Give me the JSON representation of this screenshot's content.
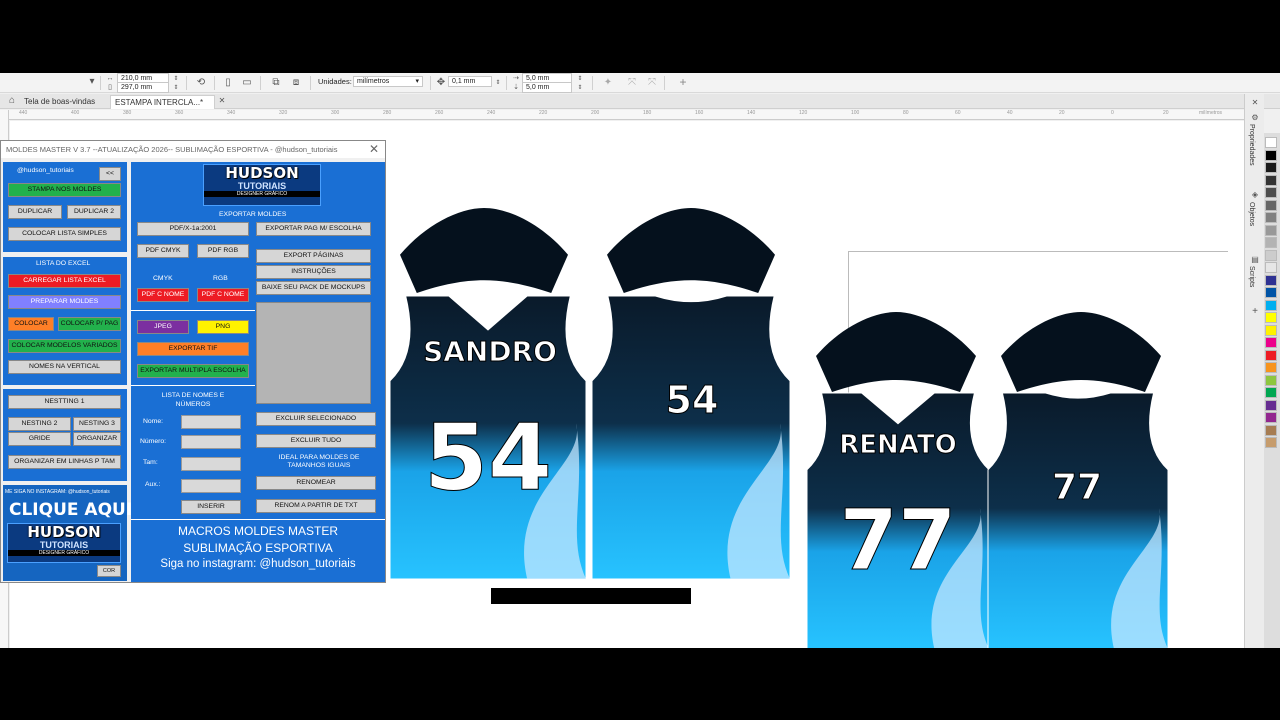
{
  "propbar": {
    "width": "210,0 mm",
    "height": "297,0 mm",
    "units_label": "Unidades:",
    "units_value": "milímetros",
    "nudge": "0,1 mm",
    "dup_x": "5,0 mm",
    "dup_y": "5,0 mm"
  },
  "tabs": {
    "welcome": "Tela de boas-vindas",
    "document": "ESTAMPA INTERCLA...*"
  },
  "ruler": {
    "ticks": [
      "440",
      "400",
      "380",
      "360",
      "340",
      "320",
      "300",
      "280",
      "260",
      "240",
      "220",
      "200",
      "180",
      "160",
      "140",
      "120",
      "100",
      "80",
      "60",
      "40",
      "20",
      "0",
      "20"
    ],
    "unit": "milímetros"
  },
  "docker": {
    "tab1": "Propriedades",
    "tab2": "Objetos",
    "tab3": "Scripts"
  },
  "palette": [
    "#ffffff",
    "#000000",
    "#1a1a1a",
    "#333333",
    "#4d4d4d",
    "#666666",
    "#808080",
    "#999999",
    "#b3b3b3",
    "#cccccc",
    "#e6e6e6",
    "#2e3192",
    "#0054a6",
    "#00aeef",
    "#ffff00",
    "#fff200",
    "#ec008c",
    "#ed1c24",
    "#f7941d",
    "#8dc63f",
    "#00a651",
    "#662d91",
    "#92278f",
    "#a67c52",
    "#c69c6d"
  ],
  "dialog": {
    "title": "MOLDES  MASTER V 3.7 --ATUALIZAÇÃO 2026--  SUBLIMAÇÃO ESPORTIVA - @hudson_tutoriais",
    "handle": "@hudson_tutoriais",
    "collapse": "<<",
    "stampa": "STAMPA NOS  MOLDES",
    "duplicar": "DUPLICAR",
    "duplicar2": "DUPLICAR 2",
    "colocar_lista": "COLOCAR LISTA SIMPLES",
    "lista_excel_label": "LISTA DO EXCEL",
    "carregar": "CARREGAR LISTA EXCEL",
    "preparar": "PREPARAR MOLDES",
    "colocar": "COLOCAR",
    "colocar_pag": "COLOCAR P/ PAG",
    "colocar_variados": "COLOCAR MODELOS VARIADOS",
    "nomes_vertical": "NOMES NA VERTICAL",
    "nesting1": "NESTTING 1",
    "nesting2": "NESTING 2",
    "nesting3": "NESTING 3",
    "gride": "GRIDE",
    "organizar": "ORGANIZAR",
    "organizar_linhas": "ORGANIZAR EM LINHAS P TAM",
    "instagram_small": "ME SIGA NO INSTAGRAM: @hudson_tutoriais",
    "clique": "CLIQUE AQUI",
    "logo_line1": "HUDSON",
    "logo_line2": "TUTORIAIS",
    "logo_line3": "DESIGNER GRÁFICO",
    "cor": "COR",
    "exportar_moldes": "EXPORTAR MOLDES",
    "pdfx": "PDF/X-1a:2001",
    "pdf_cmyk": "PDF CMYK",
    "pdf_rgb": "PDF RGB",
    "cmyk_label": "CMYK",
    "rgb_label": "RGB",
    "pdf_c_nome1": "PDF C NOME",
    "pdf_c_nome2": "PDF C NOME",
    "jpeg": "JPEG",
    "png": "PNG",
    "exportar_tif": "EXPORTAR TIF",
    "exportar_multipla": "EXPORTAR MULTIPLA ESCOLHA",
    "exportar_pag": "EXPORTAR PAG M/ ESCOLHA",
    "exportar_paginas": "EXPORT PÁGINAS",
    "instrucoes": "INSTRUÇÕES",
    "baixe": "BAIXE SEU PACK DE MOCKUPS",
    "lista_nomes": "LISTA DE NOMES E NÚMEROS",
    "nome": "Nome:",
    "numero": "Número:",
    "tam": "Tam:",
    "aux": "Aux.:",
    "inserir": "INSERIR",
    "excluir_sel": "EXCLUIR SELECIONADO",
    "excluir_tudo": "EXCLUIR TUDO",
    "ideal": "IDEAL PARA MOLDES DE TAMANHOS IGUAIS",
    "renomear": "RENOMEAR",
    "renom_txt": "RENOM A PARTIR DE TXT",
    "footer1": "MACROS MOLDES MASTER",
    "footer2": "SUBLIMAÇÃO ESPORTIVA",
    "footer3": "Siga no instagram: @hudson_tutoriais"
  },
  "jerseys": [
    {
      "name": "SANDRO",
      "number": "54"
    },
    {
      "name": "RENATO",
      "number": "77"
    }
  ]
}
